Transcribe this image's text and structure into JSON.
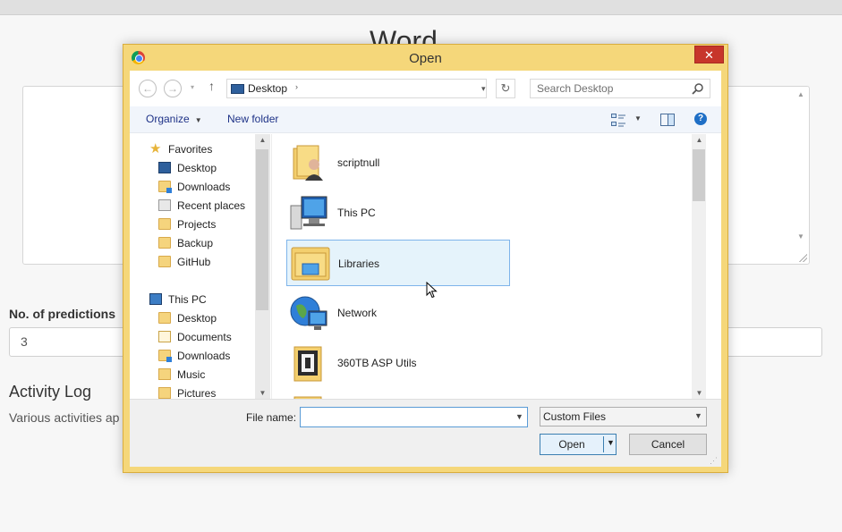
{
  "page": {
    "heading": "Word",
    "predictions_label": "No. of predictions",
    "predictions_value": "3",
    "activity_log_title": "Activity Log",
    "activity_log_text": "Various activities ap"
  },
  "dialog": {
    "title": "Open",
    "close_glyph": "✕",
    "address": {
      "location": "Desktop",
      "separator_glyph": "›",
      "dropdown_glyph": "▾",
      "refresh_glyph": "↻"
    },
    "nav_buttons": {
      "back_glyph": "←",
      "forward_glyph": "→",
      "recent_glyph": "▾",
      "up_glyph": "↑"
    },
    "search_placeholder": "Search Desktop",
    "toolbar": {
      "organize_label": "Organize",
      "new_folder_label": "New folder",
      "help_glyph": "?"
    },
    "nav_pane": {
      "favorites_label": "Favorites",
      "favorites": [
        {
          "label": "Desktop",
          "icon": "desktop-icon"
        },
        {
          "label": "Downloads",
          "icon": "downloads-folder-icon"
        },
        {
          "label": "Recent places",
          "icon": "recent-places-icon"
        },
        {
          "label": "Projects",
          "icon": "folder-icon"
        },
        {
          "label": "Backup",
          "icon": "folder-icon"
        },
        {
          "label": "GitHub",
          "icon": "folder-icon"
        }
      ],
      "this_pc_label": "This PC",
      "this_pc": [
        {
          "label": "Desktop",
          "icon": "folder-icon"
        },
        {
          "label": "Documents",
          "icon": "documents-icon"
        },
        {
          "label": "Downloads",
          "icon": "downloads-folder-icon"
        },
        {
          "label": "Music",
          "icon": "music-icon"
        },
        {
          "label": "Pictures",
          "icon": "pictures-icon"
        }
      ]
    },
    "files": [
      {
        "name": "scriptnull",
        "icon": "user-folder-icon",
        "selected": false
      },
      {
        "name": "This PC",
        "icon": "computer-icon",
        "selected": false
      },
      {
        "name": "Libraries",
        "icon": "libraries-icon",
        "selected": true
      },
      {
        "name": "Network",
        "icon": "network-icon",
        "selected": false
      },
      {
        "name": "360TB ASP Utils",
        "icon": "folder-icon",
        "selected": false
      }
    ],
    "footer": {
      "file_name_label": "File name:",
      "file_name_value": "",
      "file_type": "Custom Files",
      "open_label": "Open",
      "cancel_label": "Cancel"
    }
  },
  "colors": {
    "dialog_frame": "#f5d77a",
    "close_button": "#c7352b",
    "selection_fill": "#e5f3fb",
    "selection_border": "#7eb4ea",
    "link_blue": "#1e3287"
  }
}
